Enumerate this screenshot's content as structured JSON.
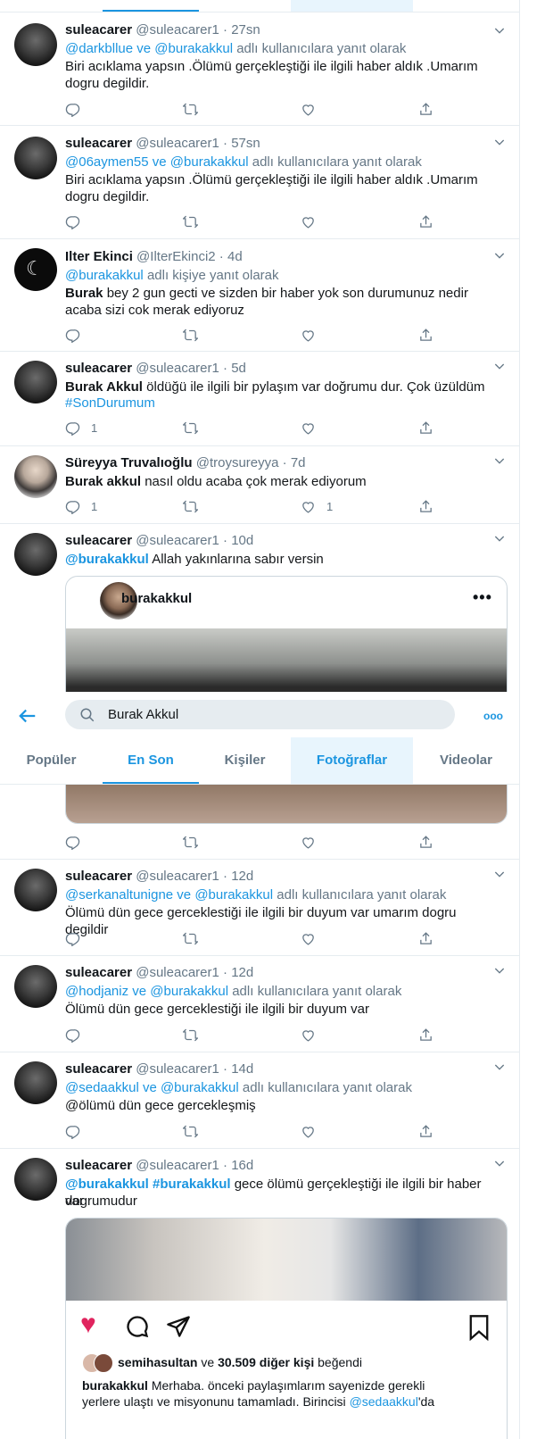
{
  "colors": {
    "accent": "#1b95e0",
    "muted": "#657786",
    "border": "#e6ecf0",
    "heart": "#e0245e"
  },
  "tweets": [
    {
      "name": "suleacarer",
      "handle": "@suleacarer1",
      "time": "27sn",
      "reply_to": {
        "users": "@darkbllue ve @burakakkul",
        "suffix": "adlı kullanıcılara yanıt olarak"
      },
      "body": "Biri acıklama yapsın .Ölümü gerçekleştiği ile ilgili haber aldık .Umarım dogru degildir.",
      "reply_count": "",
      "like_count": ""
    },
    {
      "name": "suleacarer",
      "handle": "@suleacarer1",
      "time": "57sn",
      "reply_to": {
        "users": "@06aymen55 ve @burakakkul",
        "suffix": "adlı kullanıcılara yanıt olarak"
      },
      "body": "Biri acıklama yapsın .Ölümü gerçekleştiği ile ilgili haber aldık .Umarım dogru degildir."
    },
    {
      "name": "Ilter Ekinci",
      "handle": "@IlterEkinci2",
      "time": "4d",
      "reply_to": {
        "users": "@burakakkul",
        "suffix": "adlı kişiye yanıt olarak"
      },
      "body_bold": "Burak",
      "body": "bey 2 gun gecti ve sizden bir haber yok son durumunuz nedir acaba sizi cok merak ediyoruz"
    },
    {
      "name": "suleacarer",
      "handle": "@suleacarer1",
      "time": "5d",
      "body_bold": "Burak Akkul",
      "body": " öldüğü ile ilgili bir pylaşım var doğrumu dur. Çok üzüldüm",
      "hashtag": "#SonDurumum",
      "reply_count": "1"
    },
    {
      "name": "Süreyya Truvalıoğlu",
      "handle": "@troysureyya",
      "time": "7d",
      "body_bold": "Burak akkul",
      "body": "nasıl oldu acaba çok merak ediyorum",
      "reply_count": "1",
      "like_count": "1"
    },
    {
      "name": "suleacarer",
      "handle": "@suleacarer1",
      "time": "10d",
      "mention": "@burakakkul",
      "body": "Allah yakınlarına sabır versin",
      "card_user": "burakakkul"
    },
    {
      "name": "suleacarer",
      "handle": "@suleacarer1",
      "time": "12d",
      "reply_to": {
        "users": "@serkanaltunigne ve @burakakkul",
        "suffix": "adlı kullanıcılara yanıt olarak"
      },
      "body": "Ölümü dün gece gerceklestiği ile ilgili bir duyum var umarım dogru degildir"
    },
    {
      "name": "suleacarer",
      "handle": "@suleacarer1",
      "time": "12d",
      "reply_to": {
        "users": "@hodjaniz ve @burakakkul",
        "suffix": "adlı kullanıcılara yanıt olarak"
      },
      "body": "Ölümü dün gece gerceklestiği ile ilgili bir duyum var"
    },
    {
      "name": "suleacarer",
      "handle": "@suleacarer1",
      "time": "14d",
      "reply_to": {
        "users": "@sedaakkul ve @burakakkul",
        "suffix": "adlı kullanıcılara yanıt olarak"
      },
      "body": "@ölümü dün gece gercekleşmiş"
    },
    {
      "name": "suleacarer",
      "handle": "@suleacarer1",
      "time": "16d",
      "mention": "@burakakkul #burakakkul",
      "body": "gece ölümü gerçekleştiği ile ilgili bir haber var",
      "body2": "dogrumudur"
    }
  ],
  "search": {
    "query": "Burak Akkul",
    "back": "back-arrow",
    "more": "more-dots"
  },
  "tabs": [
    {
      "label": "Popüler"
    },
    {
      "label": "En Son"
    },
    {
      "label": "Kişiler"
    },
    {
      "label": "Fotoğraflar"
    },
    {
      "label": "Videolar"
    }
  ],
  "instagram": {
    "liked_by": "semihasultan",
    "and": "ve",
    "others": "30.509 diğer kişi",
    "liked": "beğendi",
    "caption_user": "burakakkul",
    "caption": "Merhaba. önceki paylaşımlarım sayenizde gerekli",
    "caption2": "yerlere ulaştı ve misyonunu tamamladı. Birincisi",
    "caption_mention": "@sedaakkul",
    "caption_end": "'da"
  }
}
